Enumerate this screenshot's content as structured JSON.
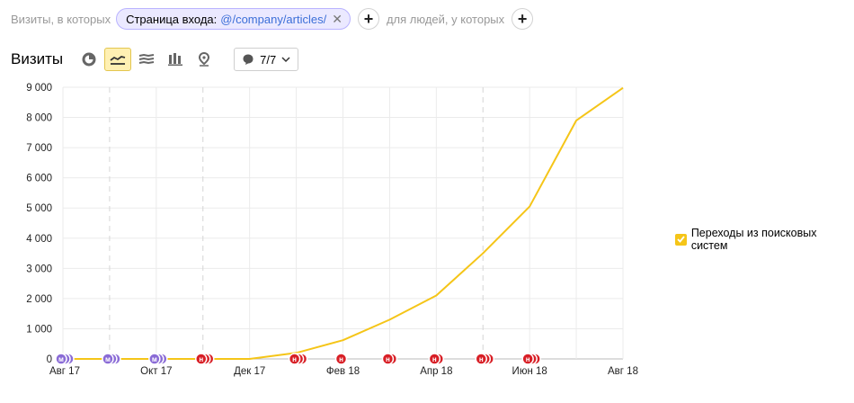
{
  "filter": {
    "prefix": "Визиты, в которых",
    "chip_label": "Страница входа:",
    "chip_value": "@/company/articles/",
    "remove_icon": "close-icon",
    "add_icon": "plus-icon",
    "middle_text": "для людей, у которых"
  },
  "toolbar": {
    "title": "Визиты",
    "buttons": [
      {
        "icon": "pie-chart-icon",
        "active": false
      },
      {
        "icon": "line-chart-icon",
        "active": true
      },
      {
        "icon": "area-chart-icon",
        "active": false
      },
      {
        "icon": "bar-chart-icon",
        "active": false
      },
      {
        "icon": "map-pin-icon",
        "active": false
      }
    ],
    "annotations_label": "7/7",
    "annotations_icon": "comment-icon",
    "dropdown_icon": "chevron-down-icon"
  },
  "legend": {
    "label": "Переходы из поисковых систем",
    "checked": true,
    "color": "#f5c518"
  },
  "chart_data": {
    "type": "line",
    "x": [
      "Авг 17",
      "Сен 17",
      "Окт 17",
      "Ноя 17",
      "Дек 17",
      "Янв 18",
      "Фев 18",
      "Мар 18",
      "Апр 18",
      "Май 18",
      "Июн 18",
      "Июл 18",
      "Авг 18"
    ],
    "x_tick_labels": [
      "Авг 17",
      "Окт 17",
      "Дек 17",
      "Фев 18",
      "Апр 18",
      "Июн 18",
      "Авг 18"
    ],
    "series": [
      {
        "name": "Переходы из поисковых систем",
        "color": "#f5c518",
        "values": [
          0,
          0,
          0,
          0,
          0,
          200,
          620,
          1300,
          2100,
          3500,
          5050,
          7900,
          8980
        ]
      }
    ],
    "y_ticks": [
      0,
      1000,
      2000,
      3000,
      4000,
      5000,
      6000,
      7000,
      8000,
      9000
    ],
    "y_tick_labels": [
      "0",
      "1 000",
      "2 000",
      "3 000",
      "4 000",
      "5 000",
      "6 000",
      "7 000",
      "8 000",
      "9 000"
    ],
    "ylim": [
      0,
      9000
    ],
    "grid": true,
    "legend_position": "right",
    "dashed_x": [
      "Сен 17",
      "Ноя 17",
      "Май 18"
    ],
    "markers": [
      {
        "x": "Авг 17",
        "letter": "м",
        "color": "#8a6bd6",
        "count": 3
      },
      {
        "x": "Сен 17",
        "letter": "м",
        "color": "#8a6bd6",
        "count": 3
      },
      {
        "x": "Окт 17",
        "letter": "м",
        "color": "#8a6bd6",
        "count": 3
      },
      {
        "x": "Ноя 17",
        "letter": "н",
        "color": "#d81f26",
        "count": 3
      },
      {
        "x": "Янв 18",
        "letter": "н",
        "color": "#d81f26",
        "count": 3
      },
      {
        "x": "Фев 18",
        "letter": "н",
        "color": "#d81f26",
        "count": 1
      },
      {
        "x": "Мар 18",
        "letter": "н",
        "color": "#d81f26",
        "count": 2
      },
      {
        "x": "Апр 18",
        "letter": "н",
        "color": "#d81f26",
        "count": 2
      },
      {
        "x": "Май 18",
        "letter": "н",
        "color": "#d81f26",
        "count": 3
      },
      {
        "x": "Июн 18",
        "letter": "н",
        "color": "#d81f26",
        "count": 3
      }
    ]
  }
}
